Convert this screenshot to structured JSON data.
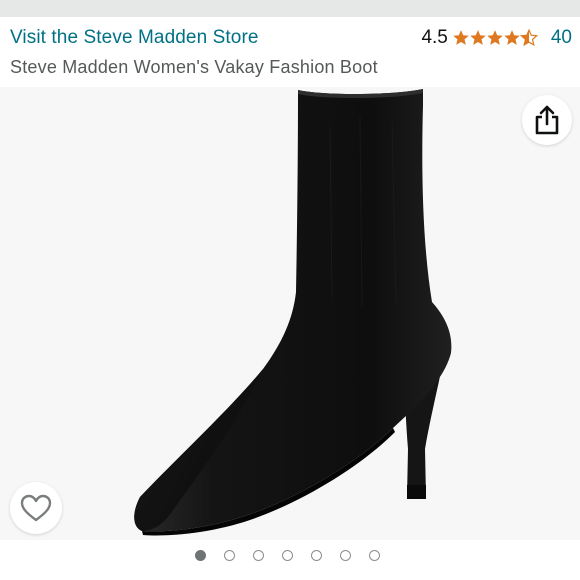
{
  "header": {
    "store_link": "Visit the Steve Madden Store",
    "rating_value": "4.5",
    "stars": [
      1,
      1,
      1,
      1,
      0.5
    ],
    "review_count": "40",
    "product_title": "Steve Madden Women's Vakay Fashion Boot"
  },
  "colors": {
    "link": "#007185",
    "star": "#de7921",
    "title": "#565959",
    "gallery_bg": "#f7f7f7"
  },
  "gallery": {
    "image": "black-suede-sock-boot-image",
    "share_icon": "share-icon",
    "wishlist_icon": "heart-outline-icon",
    "image_count": 7,
    "active_index": 0
  }
}
